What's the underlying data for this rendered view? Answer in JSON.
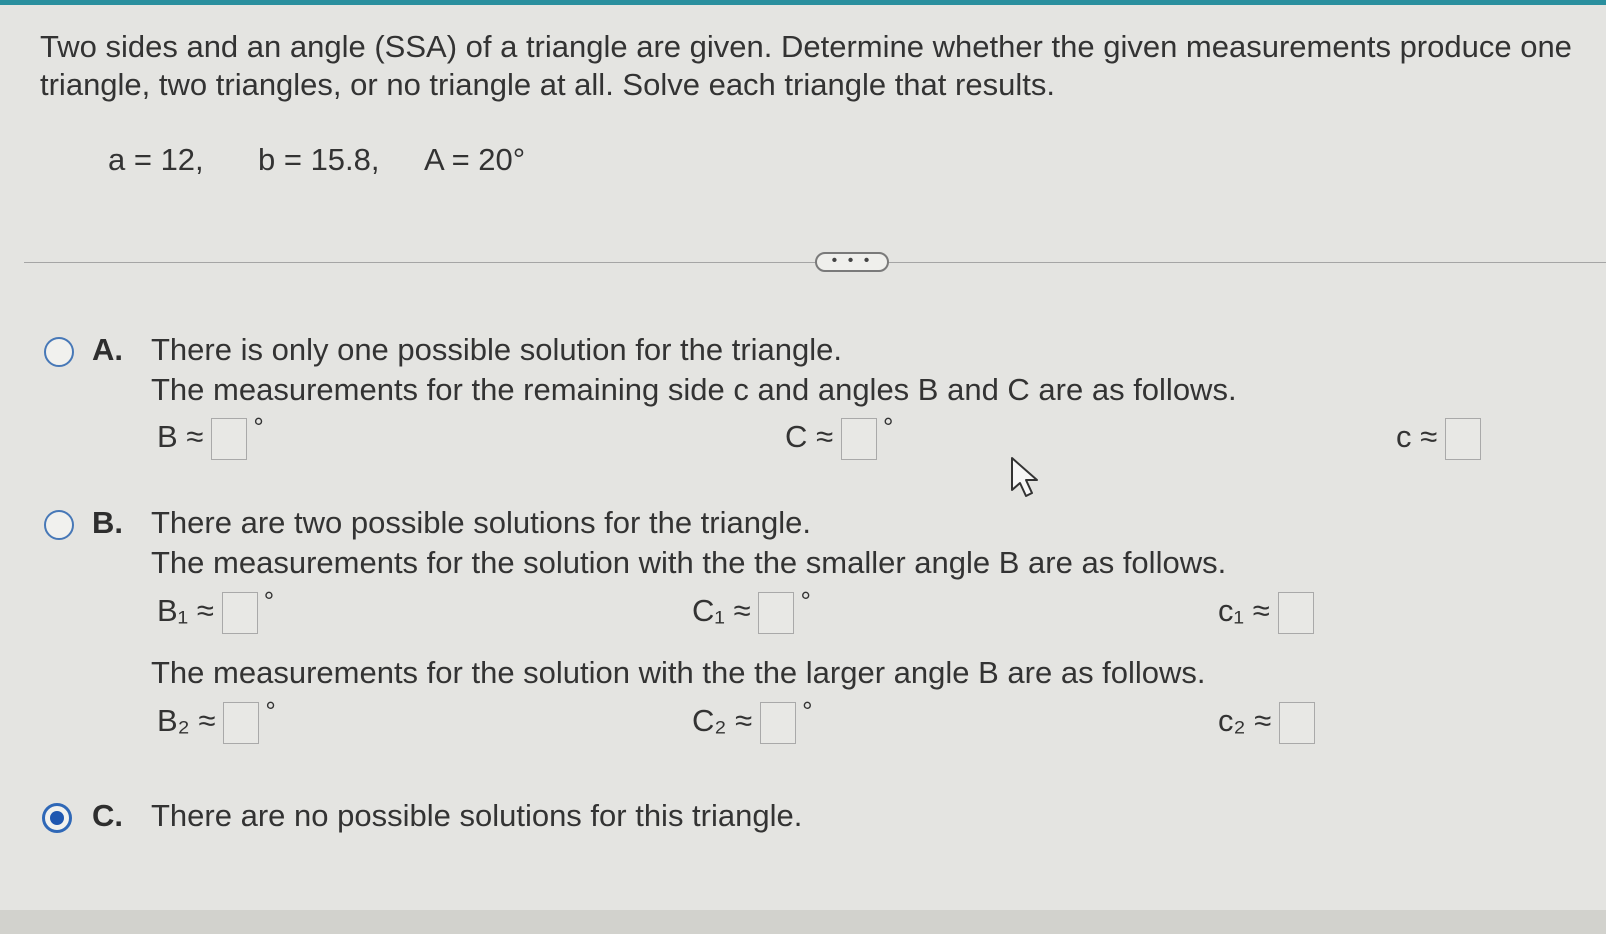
{
  "problem": {
    "text": "Two sides and an angle (SSA) of a triangle are given. Determine whether the given measurements produce one triangle, two triangles, or no triangle at all. Solve each triangle that results.",
    "given_a": "a = 12,",
    "given_b": "b = 15.8,",
    "given_A": "A = 20°"
  },
  "more_button": {
    "label": "• • •"
  },
  "options": {
    "A": {
      "letter": "A.",
      "line1": "There is only one possible solution for the triangle.",
      "line2": "The measurements for the remaining side c and angles B and C are as follows.",
      "B_label": "B ≈",
      "C_label": "C ≈",
      "c_label": "c ≈",
      "degree": "°"
    },
    "B": {
      "letter": "B.",
      "line1": "There are two possible solutions for the triangle.",
      "line2": "The measurements for the solution with the the smaller angle B are as follows.",
      "B1_label": "B₁ ≈",
      "C1_label": "C₁ ≈",
      "c1_label": "c₁ ≈",
      "line3": "The measurements for the solution with the the larger angle B are as follows.",
      "B2_label": "B₂ ≈",
      "C2_label": "C₂ ≈",
      "c2_label": "c₂ ≈",
      "degree": "°"
    },
    "C": {
      "letter": "C.",
      "line1": "There are no possible solutions for this triangle."
    },
    "selected": "C"
  },
  "colors": {
    "accent": "#2a8f9e",
    "radio": "#2f68b7",
    "radio_fill": "#1f57b0"
  }
}
